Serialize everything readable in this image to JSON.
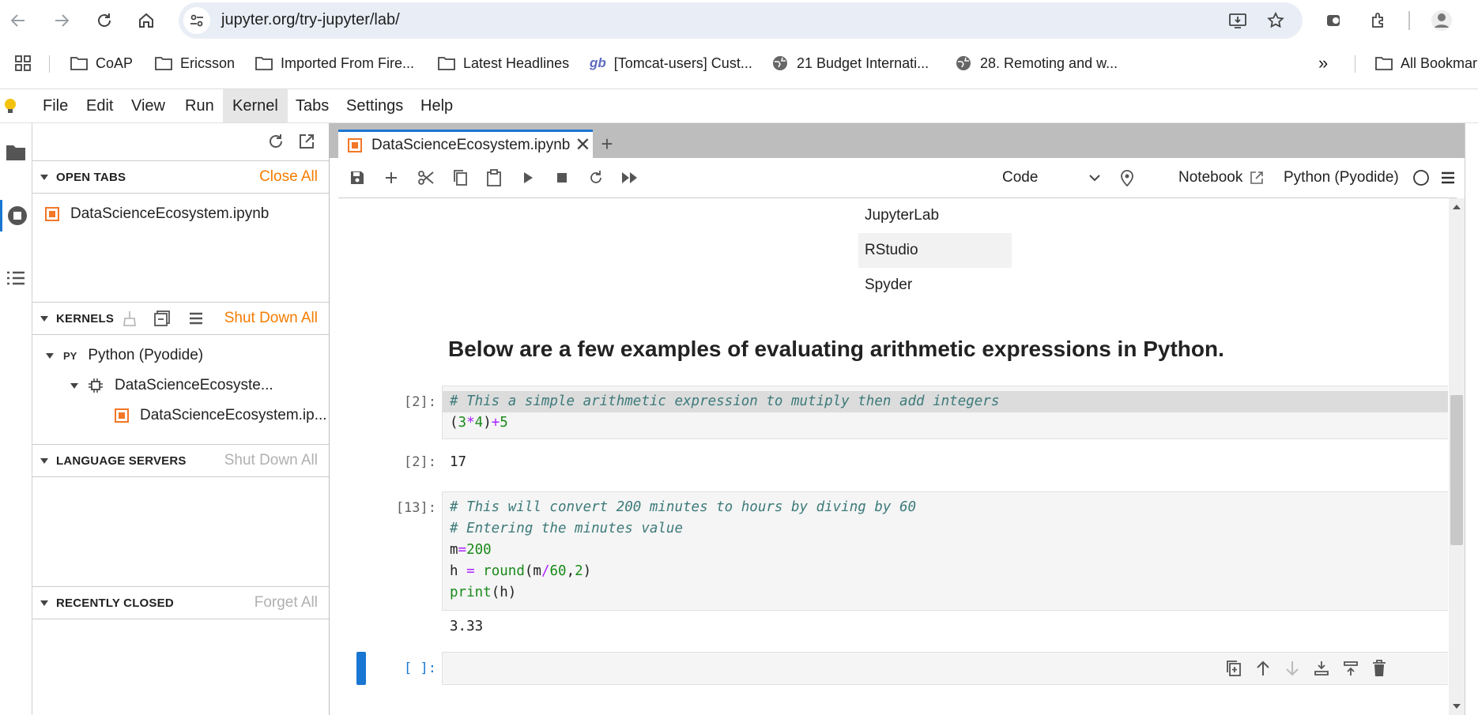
{
  "browser": {
    "url": "jupyter.org/try-jupyter/lab/",
    "bookmarks": [
      {
        "icon": "folder-icon",
        "label": "CoAP"
      },
      {
        "icon": "folder-icon",
        "label": "Ericsson"
      },
      {
        "icon": "folder-icon",
        "label": "Imported From Fire..."
      },
      {
        "icon": "folder-icon",
        "label": "Latest Headlines"
      },
      {
        "icon": "gb-icon",
        "label": "[Tomcat-users] Cust..."
      },
      {
        "icon": "globe-icon",
        "label": "21 Budget Internati..."
      },
      {
        "icon": "globe-icon",
        "label": "28. Remoting and w..."
      }
    ],
    "more_bookmarks": "»",
    "all_bookmarks": "All Bookmarks"
  },
  "menu": [
    "File",
    "Edit",
    "View",
    "Run",
    "Kernel",
    "Tabs",
    "Settings",
    "Help"
  ],
  "menu_active": "Kernel",
  "sidebar": {
    "open_tabs": {
      "title": "OPEN TABS",
      "action": "Close All",
      "items": [
        "DataScienceEcosystem.ipynb"
      ]
    },
    "kernels": {
      "title": "KERNELS",
      "action": "Shut Down All",
      "kernel": "Python (Pyodide)",
      "session": "DataScienceEcosyste...",
      "document": "DataScienceEcosystem.ip..."
    },
    "language_servers": {
      "title": "LANGUAGE SERVERS",
      "action": "Shut Down All"
    },
    "recently_closed": {
      "title": "RECENTLY CLOSED",
      "action": "Forget All"
    }
  },
  "tab": {
    "title": "DataScienceEcosystem.ipynb",
    "new_tab": "+"
  },
  "toolbar": {
    "cell_type": "Code",
    "notebook_label": "Notebook",
    "kernel_name": "Python (Pyodide)"
  },
  "notebook": {
    "list_items": [
      "JupyterLab",
      "RStudio",
      "Spyder"
    ],
    "heading": "Below are a few examples of evaluating arithmetic expressions in Python.",
    "cells": [
      {
        "prompt": "[2]:",
        "comment": "# This a simple arithmetic expression to mutiply then add integers",
        "code": "(3*4)+5",
        "output_prompt": "[2]:",
        "output": "17"
      },
      {
        "prompt": "[13]:",
        "comment1": "# This will convert 200 minutes to hours by diving by 60",
        "comment2": "# Entering the minutes value",
        "code1": "m=200",
        "code2": "h = round(m/60,2)",
        "code3": "print(h)",
        "output": "3.33"
      },
      {
        "prompt": "[ ]:"
      }
    ]
  }
}
